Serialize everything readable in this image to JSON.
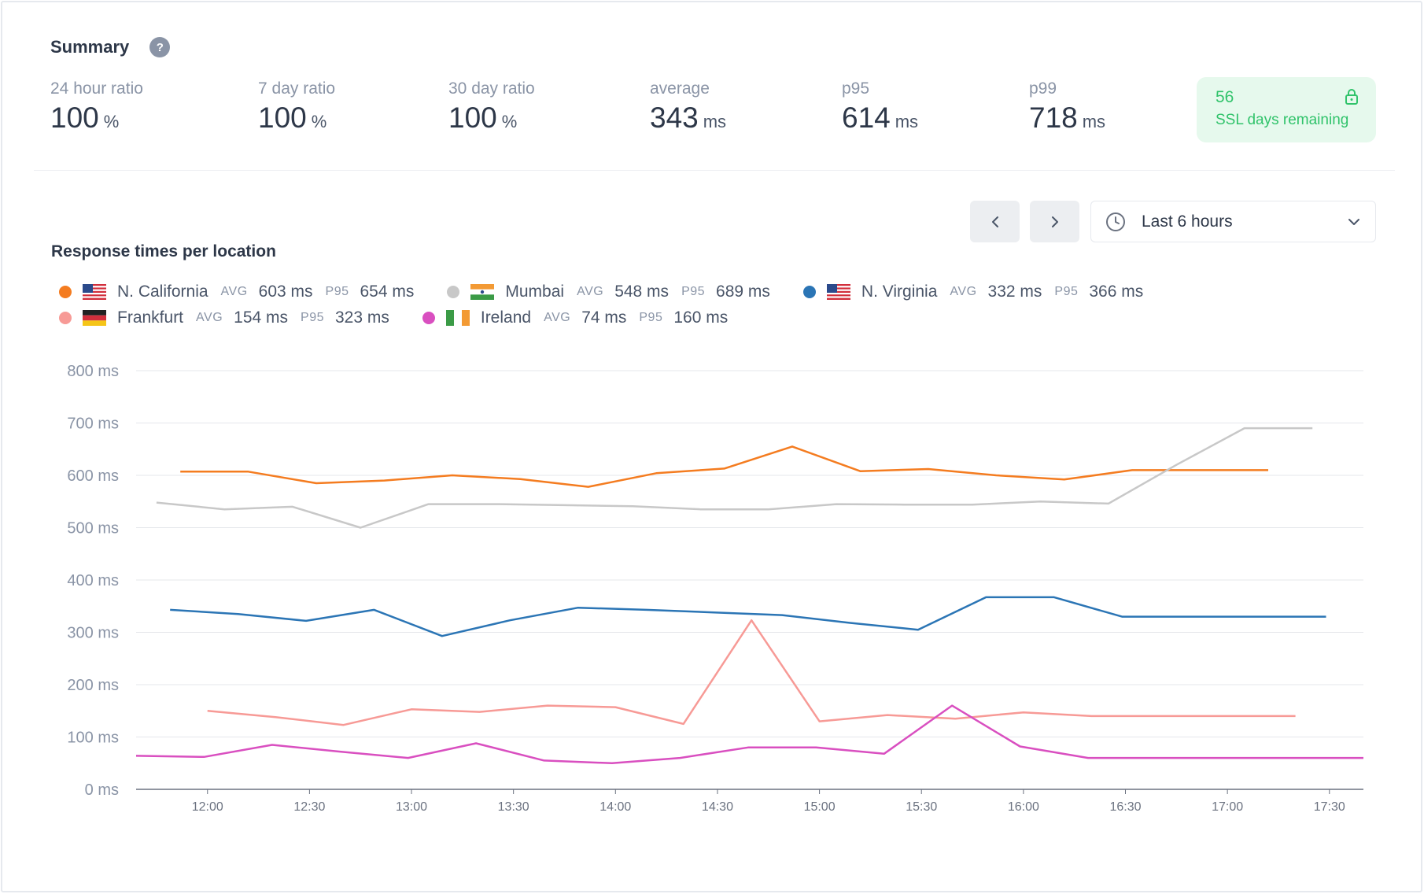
{
  "summary": {
    "title": "Summary",
    "help_glyph": "?",
    "stats": [
      {
        "label": "24 hour ratio",
        "value": "100",
        "unit": "%"
      },
      {
        "label": "7 day ratio",
        "value": "100",
        "unit": "%"
      },
      {
        "label": "30 day ratio",
        "value": "100",
        "unit": "%"
      },
      {
        "label": "average",
        "value": "343",
        "unit": "ms"
      },
      {
        "label": "p95",
        "value": "614",
        "unit": "ms"
      },
      {
        "label": "p99",
        "value": "718",
        "unit": "ms"
      }
    ],
    "ssl": {
      "days": "56",
      "label": "SSL days remaining"
    }
  },
  "controls": {
    "prev_icon": "chevron-left-icon",
    "next_icon": "chevron-right-icon",
    "range_label": "Last 6 hours"
  },
  "chart_title": "Response times per location",
  "legend": [
    {
      "name": "N. California",
      "avg": "603 ms",
      "p95": "654 ms",
      "color": "#f47c20",
      "flag": "us"
    },
    {
      "name": "Mumbai",
      "avg": "548 ms",
      "p95": "689 ms",
      "color": "#c8c8c8",
      "flag": "in"
    },
    {
      "name": "N. Virginia",
      "avg": "332 ms",
      "p95": "366 ms",
      "color": "#2b75b5",
      "flag": "us"
    },
    {
      "name": "Frankfurt",
      "avg": "154 ms",
      "p95": "323 ms",
      "color": "#f79a96",
      "flag": "de"
    },
    {
      "name": "Ireland",
      "avg": "74 ms",
      "p95": "160 ms",
      "color": "#d94fc0",
      "flag": "ie"
    }
  ],
  "legend_keys": {
    "avg": "AVG",
    "p95": "P95"
  },
  "chart_data": {
    "type": "line",
    "title": "",
    "xlabel": "",
    "ylabel": "",
    "y_ticks": [
      "0 ms",
      "100 ms",
      "200 ms",
      "300 ms",
      "400 ms",
      "500 ms",
      "600 ms",
      "700 ms",
      "800 ms"
    ],
    "ylim": [
      0,
      800
    ],
    "x_ticks": [
      "12:00",
      "12:30",
      "13:00",
      "13:30",
      "14:00",
      "14:30",
      "15:00",
      "15:30",
      "16:00",
      "16:30",
      "17:00",
      "17:30"
    ],
    "x_unit": "minutes",
    "xlim": [
      "11:39",
      "17:40"
    ],
    "grid": true,
    "series": [
      {
        "name": "N. California",
        "color": "#f47c20",
        "x": [
          "11:52",
          "12:12",
          "12:32",
          "12:52",
          "13:12",
          "13:32",
          "13:52",
          "14:12",
          "14:32",
          "14:52",
          "15:12",
          "15:32",
          "15:52",
          "16:12",
          "16:32",
          "16:52",
          "17:12"
        ],
        "y": [
          607,
          607,
          585,
          590,
          600,
          593,
          578,
          604,
          613,
          655,
          608,
          612,
          600,
          592,
          610,
          610,
          610
        ]
      },
      {
        "name": "Mumbai",
        "color": "#c8c8c8",
        "x": [
          "11:45",
          "12:05",
          "12:25",
          "12:45",
          "13:05",
          "13:25",
          "13:45",
          "14:05",
          "14:25",
          "14:45",
          "15:05",
          "15:25",
          "15:45",
          "16:05",
          "16:25",
          "16:45",
          "17:05",
          "17:25"
        ],
        "y": [
          548,
          535,
          540,
          500,
          545,
          545,
          543,
          541,
          535,
          535,
          545,
          544,
          544,
          550,
          546,
          620,
          690,
          690
        ]
      },
      {
        "name": "N. Virginia",
        "color": "#2b75b5",
        "x": [
          "11:49",
          "12:09",
          "12:29",
          "12:49",
          "13:09",
          "13:29",
          "13:49",
          "14:09",
          "14:29",
          "14:49",
          "15:09",
          "15:29",
          "15:49",
          "16:09",
          "16:29",
          "16:49",
          "17:09",
          "17:29"
        ],
        "y": [
          343,
          335,
          322,
          343,
          293,
          323,
          347,
          343,
          338,
          333,
          318,
          305,
          367,
          367,
          330,
          330,
          330,
          330
        ]
      },
      {
        "name": "Frankfurt",
        "color": "#f79a96",
        "x": [
          "12:00",
          "12:20",
          "12:40",
          "13:00",
          "13:20",
          "13:40",
          "14:00",
          "14:20",
          "14:40",
          "15:00",
          "15:20",
          "15:40",
          "16:00",
          "16:20",
          "16:40",
          "17:00",
          "17:20"
        ],
        "y": [
          150,
          138,
          123,
          153,
          148,
          160,
          157,
          125,
          323,
          130,
          142,
          135,
          147,
          140,
          140,
          140,
          140
        ]
      },
      {
        "name": "Ireland",
        "color": "#d94fc0",
        "x": [
          "11:39",
          "11:59",
          "12:19",
          "12:39",
          "12:59",
          "13:19",
          "13:39",
          "13:59",
          "14:19",
          "14:39",
          "14:59",
          "15:19",
          "15:39",
          "15:59",
          "16:19",
          "16:39",
          "16:59",
          "17:19",
          "17:40"
        ],
        "y": [
          64,
          62,
          85,
          72,
          60,
          88,
          55,
          50,
          60,
          80,
          80,
          68,
          160,
          82,
          60,
          60,
          60,
          60,
          60
        ]
      }
    ]
  }
}
